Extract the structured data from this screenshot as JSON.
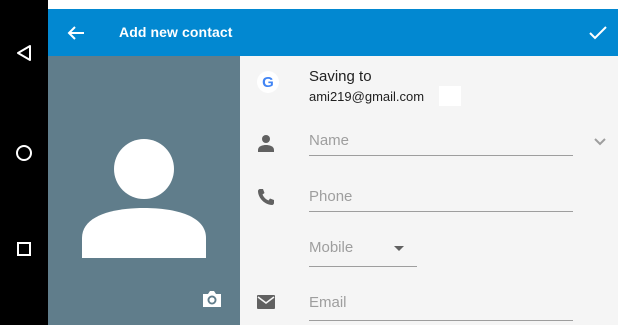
{
  "system_nav": {
    "back_icon": "triangle-back-icon",
    "home_icon": "circle-home-icon",
    "recents_icon": "square-recents-icon"
  },
  "app_bar": {
    "title": "Add new contact",
    "back_icon": "arrow-back-icon",
    "save_icon": "check-icon",
    "color": "#0288d1"
  },
  "photo": {
    "bg_color": "#607d8b",
    "camera_icon": "camera-icon"
  },
  "account": {
    "label": "Saving to",
    "email": "ami219@gmail.com",
    "logo_letter": "G"
  },
  "fields": {
    "name_placeholder": "Name",
    "phone_placeholder": "Phone",
    "phone_type": "Mobile",
    "email_placeholder": "Email"
  }
}
